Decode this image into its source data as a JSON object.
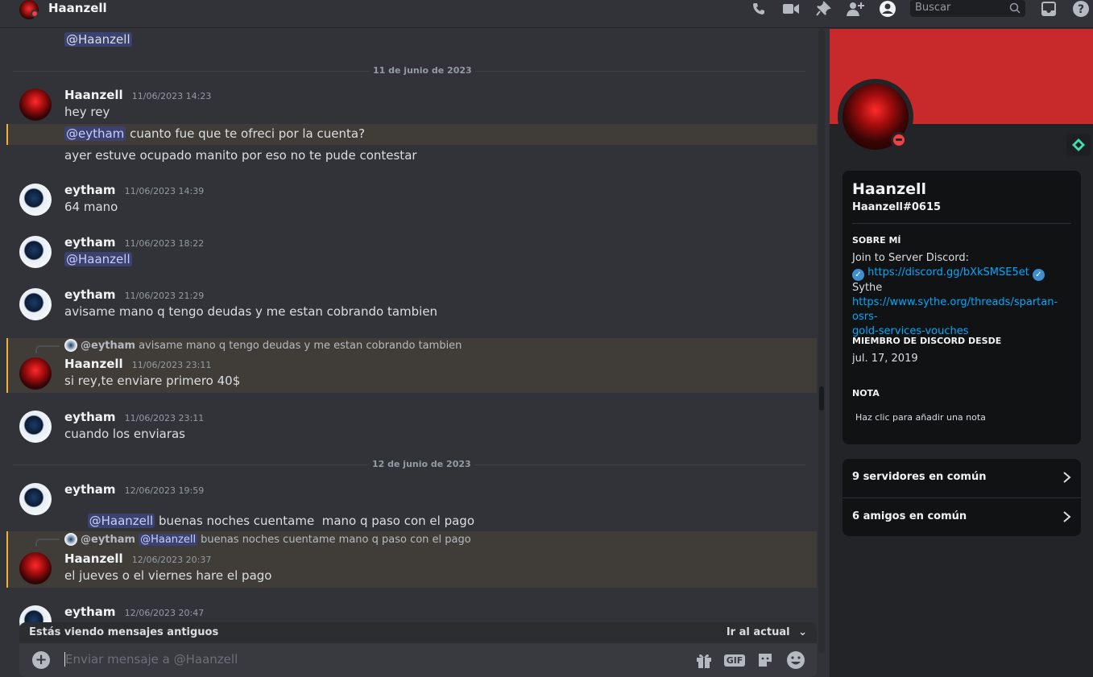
{
  "header": {
    "title": "Haanzell",
    "search_placeholder": "Buscar"
  },
  "chat": {
    "top_mention": "@Haanzell",
    "dividers": [
      "11 de junio de 2023",
      "12 de junio de 2023"
    ],
    "messages": [
      {
        "author": "Haanzell",
        "time": "11/06/2023 14:23",
        "lines": [
          "hey rey"
        ]
      },
      {
        "mention": "@eytham",
        "text": " cuanto fue que te ofreci por la cuenta?"
      },
      {
        "text": "ayer estuve ocupado manito por eso no te pude contestar"
      },
      {
        "author": "eytham",
        "time": "11/06/2023 14:39",
        "text": "64 mano"
      },
      {
        "author": "eytham",
        "time": "11/06/2023 18:22",
        "mention": "@Haanzell"
      },
      {
        "author": "eytham",
        "time": "11/06/2023 21:29",
        "text": "avisame mano q tengo deudas y me estan cobrando tambien"
      },
      {
        "reply_author": "@eytham",
        "reply_text": "avisame mano q tengo deudas y me estan cobrando tambien",
        "author": "Haanzell",
        "time": "11/06/2023 23:11",
        "text": "si rey,te enviare primero 40$"
      },
      {
        "author": "eytham",
        "time": "11/06/2023 23:11",
        "text": "cuando los enviaras"
      },
      {
        "author": "eytham",
        "time": "12/06/2023 19:59",
        "mention": "@Haanzell",
        "text": " buenas noches cuentame  mano q paso con el pago"
      },
      {
        "reply_author": "@eytham",
        "reply_mention": "@Haanzell",
        "reply_text": "buenas noches cuentame mano q paso con el pago",
        "author": "Haanzell",
        "time": "12/06/2023 20:37",
        "text": "el jueves o el viernes hare el pago"
      },
      {
        "author": "eytham",
        "time": "12/06/2023 20:47"
      }
    ]
  },
  "old_messages_bar": {
    "label": "Estás viendo mensajes antiguos",
    "jump": "Ir al actual"
  },
  "composer": {
    "placeholder": "Enviar mensaje a @Haanzell",
    "gif": "GIF"
  },
  "profile": {
    "name": "Haanzell",
    "tag": "Haanzell#0615",
    "about_title": "SOBRE MÍ",
    "about_line1": "Join to Server Discord:",
    "about_link1": "https://discord.gg/bXkSMSE5et",
    "about_line2": "Sythe",
    "about_link2a": "https://www.sythe.org/threads/spartan-osrs-",
    "about_link2b": "gold-services-vouches",
    "member_title": "MIEMBRO DE DISCORD DESDE",
    "member_since": "jul. 17, 2019",
    "note_title": "NOTA",
    "note_placeholder": "Haz clic para añadir una nota",
    "servers": "9 servidores en común",
    "friends": "6 amigos en común"
  },
  "colors": {
    "banner": "#c8292a",
    "dnd": "#f23f43",
    "mention_bg": "#3c4270",
    "highlight_border": "#f0b232",
    "link": "#00a8fc"
  }
}
